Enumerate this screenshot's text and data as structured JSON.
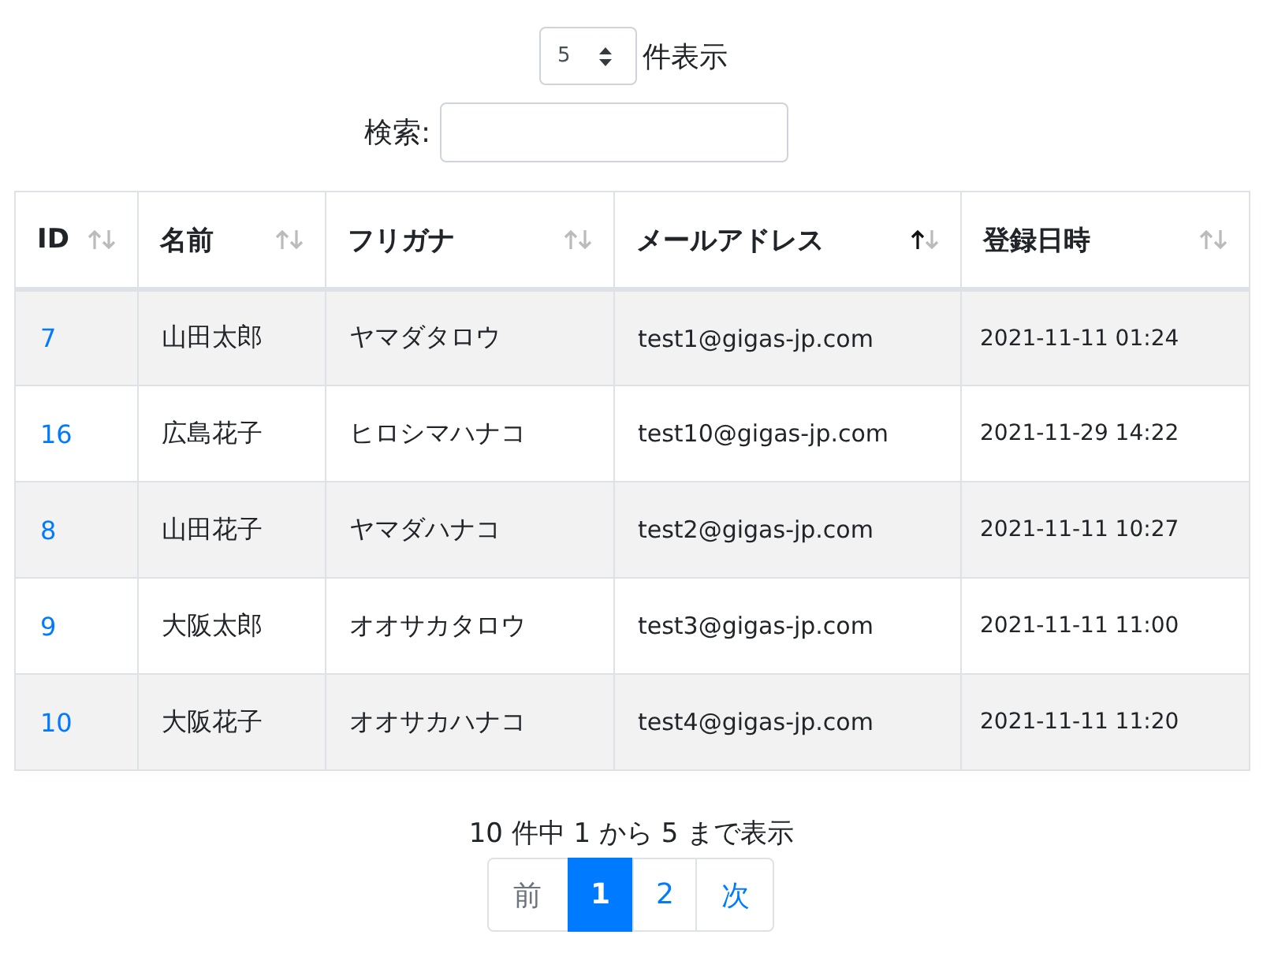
{
  "length_menu": {
    "value": "5",
    "label": "件表示"
  },
  "search": {
    "label": "検索:"
  },
  "table": {
    "columns": [
      {
        "label": "ID",
        "sorted_ascending": false
      },
      {
        "label": "名前",
        "sorted_ascending": false
      },
      {
        "label": "フリガナ",
        "sorted_ascending": false
      },
      {
        "label": "メールアドレス",
        "sorted_ascending": true
      },
      {
        "label": "登録日時",
        "sorted_ascending": false
      }
    ],
    "rows": [
      {
        "id": "7",
        "name": "山田太郎",
        "kana": "ヤマダタロウ",
        "email": "test1@gigas-jp.com",
        "date": "2021-11-11 01:24"
      },
      {
        "id": "16",
        "name": "広島花子",
        "kana": "ヒロシマハナコ",
        "email": "test10@gigas-jp.com",
        "date": "2021-11-29 14:22"
      },
      {
        "id": "8",
        "name": "山田花子",
        "kana": "ヤマダハナコ",
        "email": "test2@gigas-jp.com",
        "date": "2021-11-11 10:27"
      },
      {
        "id": "9",
        "name": "大阪太郎",
        "kana": "オオサカタロウ",
        "email": "test3@gigas-jp.com",
        "date": "2021-11-11 11:00"
      },
      {
        "id": "10",
        "name": "大阪花子",
        "kana": "オオサカハナコ",
        "email": "test4@gigas-jp.com",
        "date": "2021-11-11 11:20"
      }
    ]
  },
  "info": "10 件中 1 から 5 まで表示",
  "pagination": [
    {
      "label": "前",
      "selected": false,
      "disabled": true
    },
    {
      "label": "1",
      "selected": true,
      "disabled": false
    },
    {
      "label": "2",
      "selected": false,
      "disabled": false
    },
    {
      "label": "次",
      "selected": false,
      "disabled": false
    }
  ]
}
